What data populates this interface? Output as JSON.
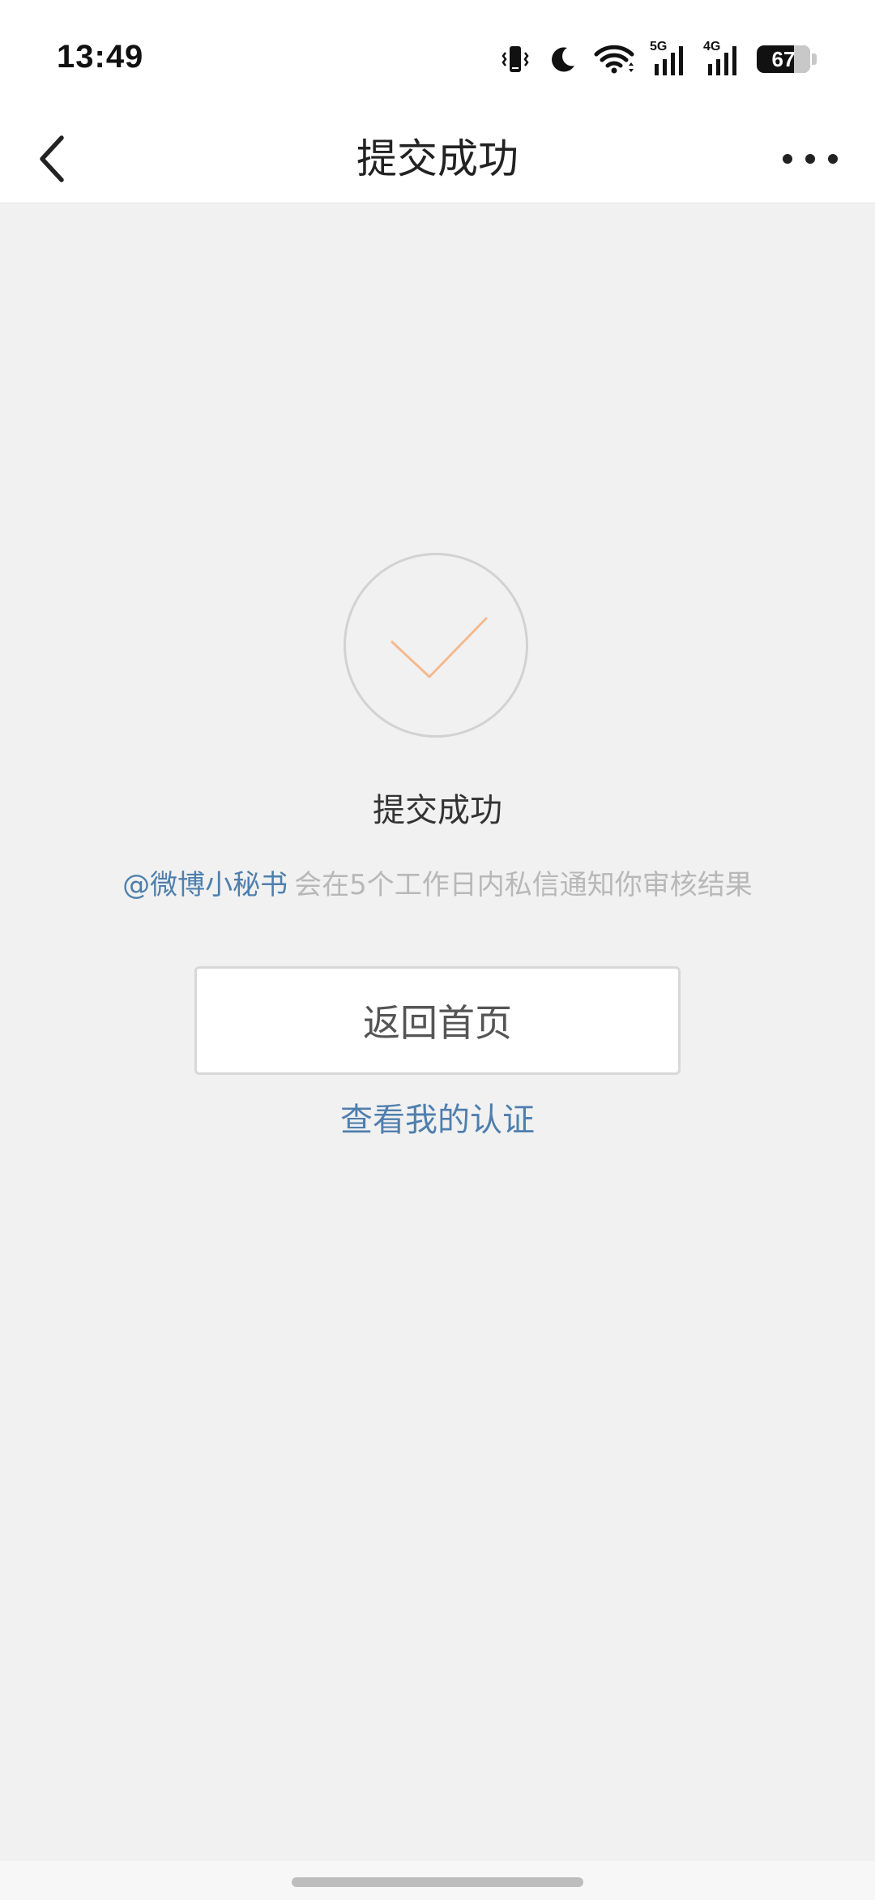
{
  "status_bar": {
    "time": "13:49",
    "icons": [
      "vibrate-icon",
      "moon-icon",
      "wifi-icon",
      "signal-5g-icon",
      "signal-4g-icon"
    ],
    "signal_5g_label": "5G",
    "signal_4g_label": "4G",
    "battery_level": "67"
  },
  "nav": {
    "title": "提交成功",
    "back_icon": "chevron-left-icon",
    "more_icon": "more-horizontal-icon"
  },
  "content": {
    "success_icon": "checkmark-icon",
    "success_title": "提交成功",
    "mention": "@微博小秘书",
    "notice": "会在5个工作日内私信通知你审核结果",
    "home_button_label": "返回首页",
    "view_cert_link": "查看我的认证"
  },
  "colors": {
    "background": "#f1f1f1",
    "link_blue": "#4f7fad",
    "check_orange": "#f4b98e",
    "muted_text": "#b8b8b8"
  }
}
